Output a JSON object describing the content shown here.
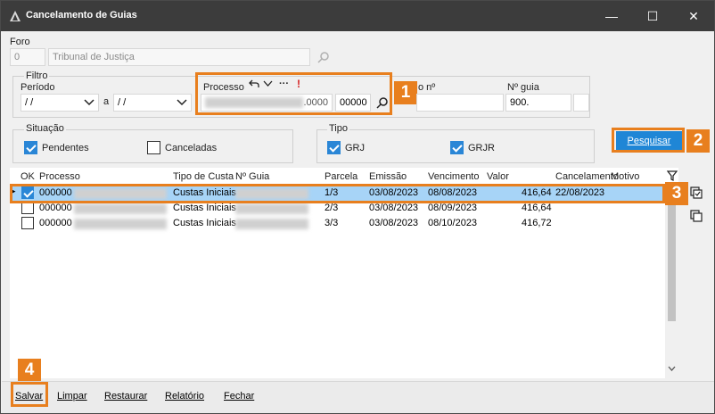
{
  "window": {
    "title": "Cancelamento de Guias",
    "minimize": "—",
    "maximize": "☐",
    "close": "✕"
  },
  "foro": {
    "label": "Foro",
    "code": "0",
    "name_placeholder": "Tribunal de Justiça"
  },
  "filtro": {
    "label": "Filtro",
    "periodo_label": "Período",
    "date_from": " / /",
    "sep": "a",
    "date_to": " / /",
    "processo_label": "Processo",
    "processo_suffix": ".0000",
    "processo_field2": "00000",
    "processo_tail_label": "o nº",
    "nguia_label": "Nº guia",
    "nguia_value": "900."
  },
  "situacao": {
    "label": "Situação",
    "pendentes": "Pendentes",
    "pendentes_checked": true,
    "canceladas": "Canceladas",
    "canceladas_checked": false
  },
  "tipo": {
    "label": "Tipo",
    "grj": "GRJ",
    "grj_checked": true,
    "grjr": "GRJR",
    "grjr_checked": true
  },
  "search_button": "Pesquisar",
  "table": {
    "columns": [
      "OK",
      "Processo",
      "Tipo de Custa",
      "Nº Guia",
      "Parcela",
      "Emissão",
      "Vencimento",
      "Valor",
      "Cancelamento",
      "Motivo"
    ],
    "rows": [
      {
        "checked": true,
        "processo": "000000",
        "tipo": "Custas Iniciais",
        "parcela": "1/3",
        "emissao": "03/08/2023",
        "vencimento": "08/08/2023",
        "valor": "416,64",
        "cancelamento": "22/08/2023"
      },
      {
        "checked": false,
        "processo": "000000",
        "tipo": "Custas Iniciais",
        "parcela": "2/3",
        "emissao": "03/08/2023",
        "vencimento": "08/09/2023",
        "valor": "416,64",
        "cancelamento": ""
      },
      {
        "checked": false,
        "processo": "000000",
        "tipo": "Custas Iniciais",
        "parcela": "3/3",
        "emissao": "03/08/2023",
        "vencimento": "08/10/2023",
        "valor": "416,72",
        "cancelamento": ""
      }
    ]
  },
  "badges": [
    "1",
    "2",
    "3",
    "4"
  ],
  "bottom": {
    "salvar": "Salvar",
    "limpar": "Limpar",
    "restaurar": "Restaurar",
    "relatorio": "Relatório",
    "fechar": "Fechar"
  },
  "colors": {
    "accent": "#e87f1e",
    "primary": "#1f86d6",
    "selected_row": "#a7d4f7",
    "titlebar": "#3c3c3c"
  },
  "icons": [
    "app-icon",
    "search-icon",
    "undo-icon",
    "chevron-down-icon",
    "more-icon",
    "alert-icon",
    "filter-icon",
    "copy-icon"
  ]
}
